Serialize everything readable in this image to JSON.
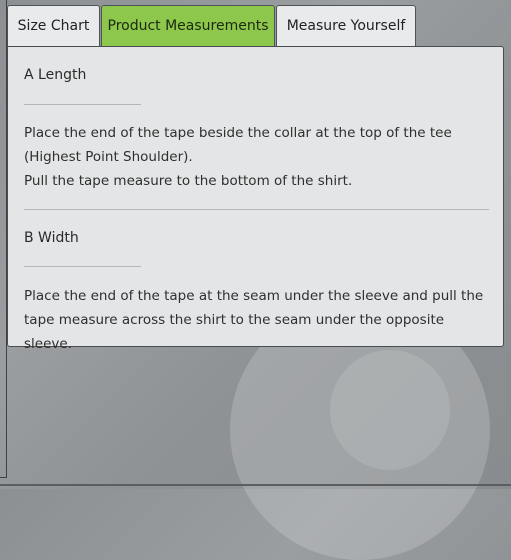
{
  "tabs": [
    {
      "label": "Size Chart",
      "active": false
    },
    {
      "label": "Product Measurements",
      "active": true
    },
    {
      "label": "Measure Yourself",
      "active": false
    }
  ],
  "sections": [
    {
      "title": "A Length",
      "lines": [
        "Place the end of the tape beside the collar at the top of the tee (Highest Point Shoulder).",
        "Pull the tape measure to the bottom of the shirt."
      ]
    },
    {
      "title": "B Width",
      "lines": [
        "Place the end of the tape at the seam under the sleeve and pull the tape measure across the shirt to the seam under the opposite sleeve."
      ]
    }
  ],
  "colors": {
    "active_tab": "#8dc74b",
    "panel_bg": "#e4e5e6",
    "page_bg": "#93979a"
  }
}
